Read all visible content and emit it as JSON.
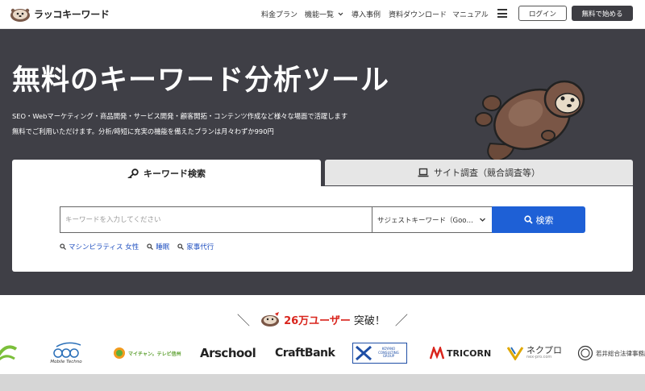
{
  "header": {
    "logo_text": "ラッコキーワード",
    "nav": [
      {
        "label": "料金プラン"
      },
      {
        "label": "機能一覧"
      },
      {
        "label": "導入事例"
      },
      {
        "label": "資料ダウンロード"
      },
      {
        "label": "マニュアル"
      }
    ],
    "login_label": "ログイン",
    "start_label": "無料で始める"
  },
  "hero": {
    "title": "無料のキーワード分析ツール",
    "sub1": "SEO・Webマーケティング・商品開発・サービス開発・顧客開拓・コンテンツ作成など様々な場面で活躍します",
    "sub2": "無料でご利用いただけます。分析/時短に充実の機能を備えたプランは月々わずか990円"
  },
  "search": {
    "tabs": [
      {
        "label": "キーワード検索",
        "icon": "key-icon",
        "active": true
      },
      {
        "label": "サイト調査（競合調査等）",
        "icon": "laptop-icon",
        "active": false
      }
    ],
    "placeholder": "キーワードを入力してください",
    "select_value": "サジェストキーワード（Google）",
    "button_label": "検索",
    "suggestions": [
      "マシンピラティス 女性",
      "睡眠",
      "家事代行"
    ]
  },
  "users": {
    "count": "26万ユーザー",
    "suffix": "突破！",
    "logos": [
      "Mobile Techno",
      "マイチャン。テレビ信州",
      "Arschool",
      "CraftBank",
      "KOYANO CONSULTING GROUP",
      "TRICORN",
      "ネクプロ",
      "nex-pro.com",
      "若井総合法律事務所"
    ]
  },
  "colors": {
    "hero_bg": "#3f3f46",
    "accent_blue": "#1e60d6",
    "count_red": "#d9251d"
  }
}
